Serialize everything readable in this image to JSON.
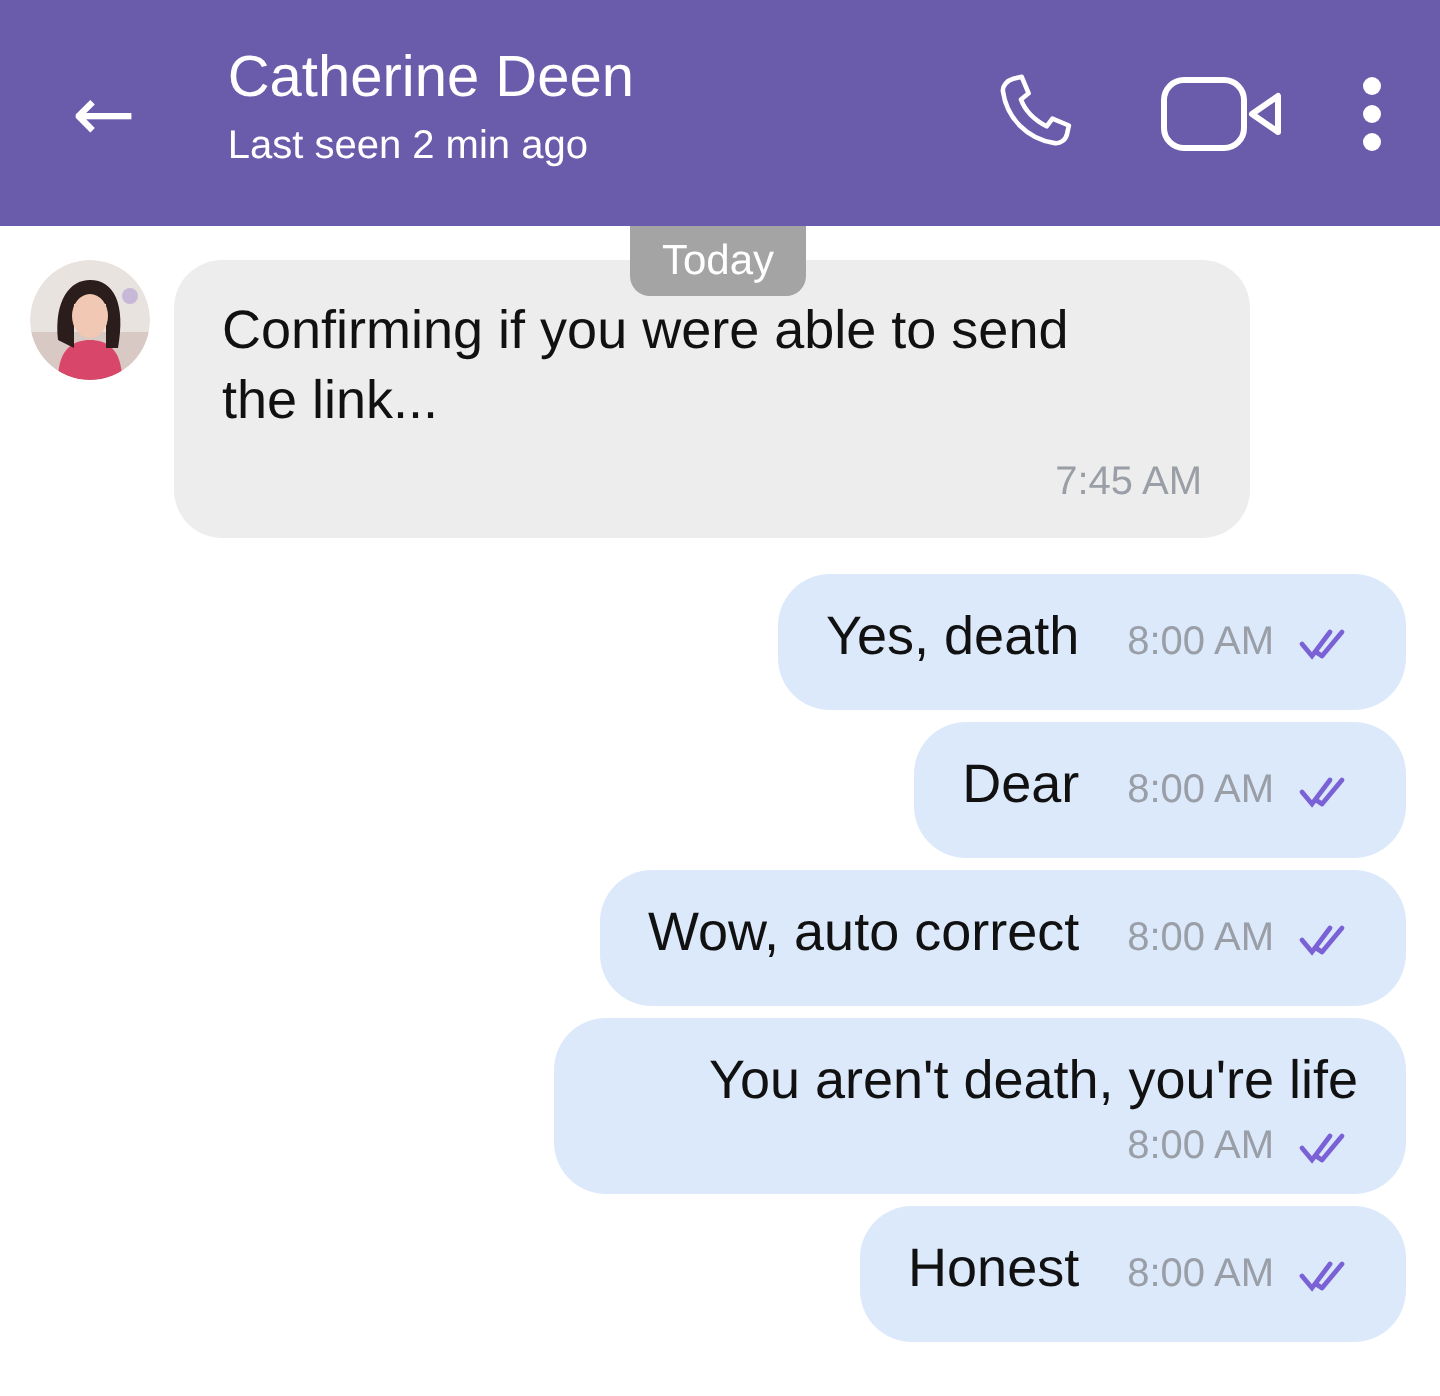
{
  "header": {
    "back": "←",
    "contact_name": "Catherine Deen",
    "status": "Last seen 2 min ago"
  },
  "date_divider": "Today",
  "messages": [
    {
      "kind": "incoming",
      "text": "Confirming if you were able to send the link...",
      "time": "7:45 AM"
    },
    {
      "kind": "outgoing",
      "text": "Yes, death",
      "time": "8:00 AM",
      "read": true
    },
    {
      "kind": "outgoing",
      "text": "Dear",
      "time": "8:00 AM",
      "read": true
    },
    {
      "kind": "outgoing",
      "text": "Wow, auto correct",
      "time": "8:00 AM",
      "read": true
    },
    {
      "kind": "outgoing",
      "text": "You aren't death, you're life",
      "time": "8:00 AM",
      "read": true
    },
    {
      "kind": "outgoing",
      "text": "Honest",
      "time": "8:00 AM",
      "read": true
    }
  ]
}
